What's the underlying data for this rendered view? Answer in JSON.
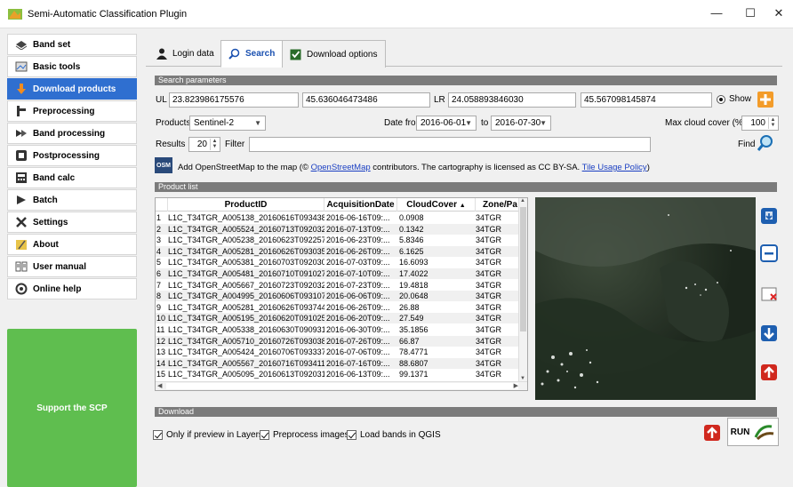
{
  "window": {
    "title": "Semi-Automatic Classification Plugin",
    "minimize": "—",
    "maximize": "☐",
    "close": "✕"
  },
  "sidebar": {
    "items": [
      {
        "label": "Band set",
        "icon": "band-set-icon"
      },
      {
        "label": "Basic tools",
        "icon": "basic-tools-icon"
      },
      {
        "label": "Download products",
        "icon": "download-icon",
        "active": true
      },
      {
        "label": "Preprocessing",
        "icon": "preprocessing-icon"
      },
      {
        "label": "Band processing",
        "icon": "band-processing-icon"
      },
      {
        "label": "Postprocessing",
        "icon": "postprocessing-icon"
      },
      {
        "label": "Band calc",
        "icon": "calculator-icon"
      },
      {
        "label": "Batch",
        "icon": "batch-icon"
      },
      {
        "label": "Settings",
        "icon": "settings-icon"
      },
      {
        "label": "About",
        "icon": "about-icon"
      },
      {
        "label": "User manual",
        "icon": "manual-icon"
      },
      {
        "label": "Online help",
        "icon": "help-icon"
      }
    ],
    "support": "Support the SCP"
  },
  "tabs": [
    {
      "label": "Login data",
      "icon": "user-icon"
    },
    {
      "label": "Search",
      "icon": "search-icon",
      "selected": true
    },
    {
      "label": "Download options",
      "icon": "checkbox-icon"
    }
  ],
  "search": {
    "header": "Search parameters",
    "ul_label": "UL",
    "ul_x": "23.823986175576",
    "ul_y": "45.636046473486",
    "lr_label": "LR",
    "lr_x": "24.058893846030",
    "lr_y": "45.567098145874",
    "show_label": "Show",
    "products_label": "Products",
    "product": "Sentinel-2",
    "date_from_label": "Date from",
    "date_from": "2016-06-01",
    "to_label": "to",
    "date_to": "2016-07-30",
    "cloud_label": "Max cloud cover (%)",
    "cloud": "100",
    "results_label": "Results",
    "results": "20",
    "filter_label": "Filter",
    "filter": "",
    "find_label": "Find",
    "osm_badge": "OSM",
    "osm_text_1": "Add OpenStreetMap to the map  (© ",
    "osm_link_1": "OpenStreetMap",
    "osm_text_2": " contributors. The cartography is licensed as CC BY-SA. ",
    "osm_link_2": "Tile Usage Policy",
    "osm_text_3": ")"
  },
  "product_list": {
    "header": "Product list",
    "columns": [
      "ProductID",
      "AcquisitionDate",
      "CloudCover",
      "Zone/Pa"
    ],
    "rows": [
      [
        "1",
        "L1C_T34TGR_A005138_20160616T093438",
        "2016-06-16T09:...",
        "0.0908",
        "34TGR"
      ],
      [
        "2",
        "L1C_T34TGR_A005524_20160713T092032",
        "2016-07-13T09:...",
        "0.1342",
        "34TGR"
      ],
      [
        "3",
        "L1C_T34TGR_A005238_20160623T092257",
        "2016-06-23T09:...",
        "5.8346",
        "34TGR"
      ],
      [
        "4",
        "L1C_T34TGR_A005281_20160626T093035",
        "2016-06-26T09:...",
        "6.1625",
        "34TGR"
      ],
      [
        "5",
        "L1C_T34TGR_A005381_20160703T092030",
        "2016-07-03T09:...",
        "16.6093",
        "34TGR"
      ],
      [
        "6",
        "L1C_T34TGR_A005481_20160710T091027",
        "2016-07-10T09:...",
        "17.4022",
        "34TGR"
      ],
      [
        "7",
        "L1C_T34TGR_A005667_20160723T092032",
        "2016-07-23T09:...",
        "19.4818",
        "34TGR"
      ],
      [
        "8",
        "L1C_T34TGR_A004995_20160606T093107",
        "2016-06-06T09:...",
        "20.0648",
        "34TGR"
      ],
      [
        "9",
        "L1C_T34TGR_A005281_20160626T093744",
        "2016-06-26T09:...",
        "26.88",
        "34TGR"
      ],
      [
        "10",
        "L1C_T34TGR_A005195_20160620T091025",
        "2016-06-20T09:...",
        "27.549",
        "34TGR"
      ],
      [
        "11",
        "L1C_T34TGR_A005338_20160630T090931",
        "2016-06-30T09:...",
        "35.1856",
        "34TGR"
      ],
      [
        "12",
        "L1C_T34TGR_A005710_20160726T093038",
        "2016-07-26T09:...",
        "66.87",
        "34TGR"
      ],
      [
        "13",
        "L1C_T34TGR_A005424_20160706T093337",
        "2016-07-06T09:...",
        "78.4771",
        "34TGR"
      ],
      [
        "14",
        "L1C_T34TGR_A005567_20160716T093411",
        "2016-07-16T09:...",
        "88.6807",
        "34TGR"
      ],
      [
        "15",
        "L1C_T34TGR_A005095_20160613T092031",
        "2016-06-13T09:...",
        "99.1371",
        "34TGR"
      ]
    ]
  },
  "download": {
    "header": "Download",
    "opt1": "Only if preview in Layers",
    "opt2": "Preprocess images",
    "opt3": "Load bands in QGIS",
    "run": "RUN"
  },
  "colors": {
    "accent": "#2f6fd0",
    "support": "#5fbe4f",
    "header_bar": "#7b7b7b"
  }
}
